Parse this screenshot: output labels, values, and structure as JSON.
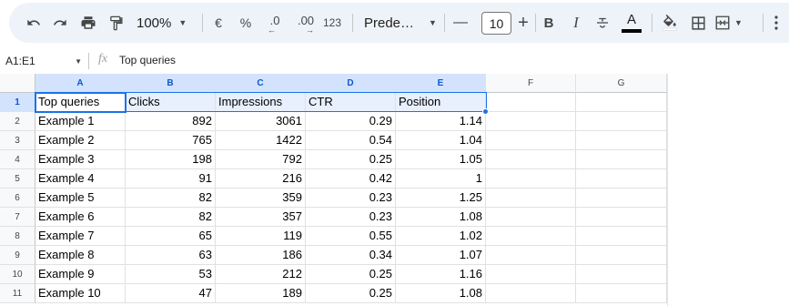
{
  "toolbar": {
    "undo_icon": "undo-icon",
    "redo_icon": "redo-icon",
    "print_icon": "print-icon",
    "paint_format_icon": "paint-format-icon",
    "zoom": "100%",
    "currency": "€",
    "percent": "%",
    "decrease_decimal": ".0",
    "increase_decimal": ".00",
    "more_formats": "123",
    "font": "Prede…",
    "decrease_size": "—",
    "font_size": "10",
    "increase_size": "+",
    "bold": "B",
    "italic": "I",
    "text_color_glyph": "A",
    "text_color": "#000000"
  },
  "formula_bar": {
    "name_box": "A1:E1",
    "fx": "fx",
    "content": "Top queries"
  },
  "sheet": {
    "columns": [
      "A",
      "B",
      "C",
      "D",
      "E",
      "F",
      "G"
    ],
    "row_numbers": [
      "1",
      "2",
      "3",
      "4",
      "5",
      "6",
      "7",
      "8",
      "9",
      "10",
      "11"
    ],
    "header_row": [
      "Top queries",
      "Clicks",
      "Impressions",
      "CTR",
      "Position"
    ],
    "rows": [
      [
        "Example 1",
        "892",
        "3061",
        "0.29",
        "1.14"
      ],
      [
        "Example 2",
        "765",
        "1422",
        "0.54",
        "1.04"
      ],
      [
        "Example 3",
        "198",
        "792",
        "0.25",
        "1.05"
      ],
      [
        "Example 4",
        "91",
        "216",
        "0.42",
        "1"
      ],
      [
        "Example 5",
        "82",
        "359",
        "0.23",
        "1.25"
      ],
      [
        "Example 6",
        "82",
        "357",
        "0.23",
        "1.08"
      ],
      [
        "Example 7",
        "65",
        "119",
        "0.55",
        "1.02"
      ],
      [
        "Example 8",
        "63",
        "186",
        "0.34",
        "1.07"
      ],
      [
        "Example 9",
        "53",
        "212",
        "0.25",
        "1.16"
      ],
      [
        "Example 10",
        "47",
        "189",
        "0.25",
        "1.08"
      ]
    ]
  }
}
